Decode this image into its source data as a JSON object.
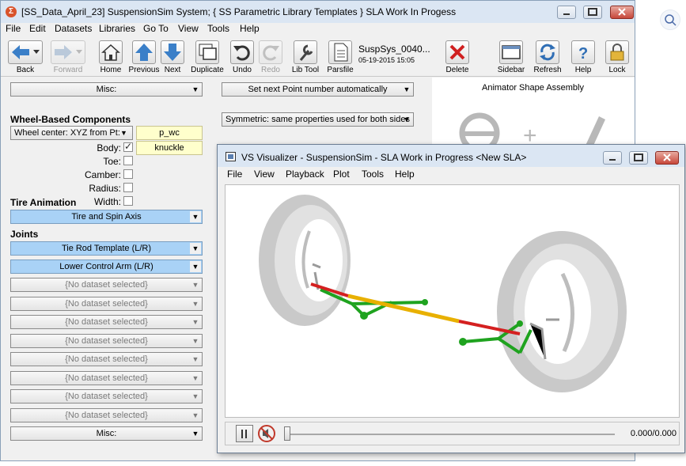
{
  "main_window": {
    "title": "[SS_Data_April_23] SuspensionSim System; { SS Parametric Library Templates } SLA Work In Progess",
    "menu": [
      "File",
      "Edit",
      "Datasets",
      "Libraries",
      "Go To",
      "View",
      "Tools",
      "Help"
    ],
    "toolbar": {
      "back": "Back",
      "forward": "Forward",
      "home": "Home",
      "previous": "Previous",
      "next": "Next",
      "duplicate": "Duplicate",
      "undo": "Undo",
      "redo": "Redo",
      "lib_tool": "Lib Tool",
      "parsfile": "Parsfile",
      "dataset_name": "SuspSys_0040...",
      "dataset_date": "05-19-2015 15:05",
      "delete": "Delete",
      "sidebar": "Sidebar",
      "refresh": "Refresh",
      "help": "Help",
      "lock": "Lock"
    }
  },
  "left_panel": {
    "misc_top": "Misc:",
    "wheel_heading": "Wheel-Based Components",
    "wheel_center_combo": "Wheel center: XYZ from Pt:",
    "wheel_center_value": "p_wc",
    "body_label": "Body:",
    "body_value": "knuckle",
    "toe_label": "Toe:",
    "camber_label": "Camber:",
    "radius_label": "Radius:",
    "width_label": "Width:",
    "tire_heading": "Tire Animation",
    "tire_combo": "Tire and Spin Axis",
    "joints_heading": "Joints",
    "joint_1": "Tie Rod Template (L/R)",
    "joint_2": "Lower Control Arm (L/R)",
    "empty_slot": "{No dataset selected}",
    "misc_bottom": "Misc:"
  },
  "middle_panel": {
    "point_combo": "Set next Point number automatically",
    "symmetric_combo": "Symmetric: same properties used for both sides"
  },
  "right_panel": {
    "title": "Animator Shape Assembly"
  },
  "visualizer": {
    "title": "VS Visualizer - SuspensionSim - SLA Work in Progress <New SLA>",
    "menu": [
      "File",
      "View",
      "Playback",
      "Plot",
      "Tools",
      "Help"
    ],
    "time_readout": "0.000/0.000",
    "slider_position": 0.0
  },
  "colors": {
    "tie_rod_center": "#e8b000",
    "tie_rod_ends": "#d42020",
    "control_arm": "#1fa31f",
    "tire": "#d4d4d4",
    "selected_combo": "#a9d2f6"
  }
}
